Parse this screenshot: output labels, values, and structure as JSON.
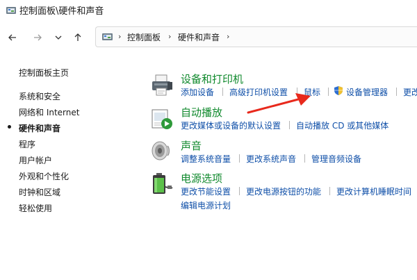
{
  "window": {
    "title": "控制面板\\硬件和声音",
    "app_icon": "control-panel-icon"
  },
  "nav": {
    "back_icon": "arrow-left-icon",
    "forward_icon": "arrow-right-icon",
    "recent_icon": "chevron-down-icon",
    "up_icon": "arrow-up-icon"
  },
  "address": {
    "crumbs": [
      "控制面板",
      "硬件和声音"
    ],
    "separator": "›"
  },
  "sidebar": {
    "home": "控制面板主页",
    "items": [
      "系统和安全",
      "网络和 Internet",
      "硬件和声音",
      "程序",
      "用户帐户",
      "外观和个性化",
      "时钟和区域",
      "轻松使用"
    ],
    "current_index": 2
  },
  "categories": [
    {
      "title": "设备和打印机",
      "icon": "printer-icon",
      "links": [
        "添加设备",
        "高级打印机设置",
        "鼠标",
        "设备管理器",
        "更改"
      ]
    },
    {
      "title": "自动播放",
      "icon": "autoplay-icon",
      "links": [
        "更改媒体或设备的默认设置",
        "自动播放 CD 或其他媒体"
      ]
    },
    {
      "title": "声音",
      "icon": "speaker-icon",
      "links": [
        "调整系统音量",
        "更改系统声音",
        "管理音频设备"
      ]
    },
    {
      "title": "电源选项",
      "icon": "battery-icon",
      "links": [
        "更改节能设置",
        "更改电源按钮的功能",
        "更改计算机睡眠时间",
        "编辑电源计划"
      ]
    }
  ],
  "annotation": {
    "icon": "red-arrow-icon",
    "color": "#e8291c"
  },
  "colors": {
    "category_title": "#118a2e",
    "link": "#0f4fa8"
  }
}
